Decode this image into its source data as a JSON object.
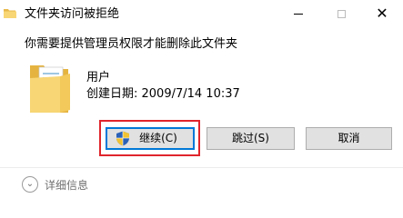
{
  "window": {
    "title": "文件夹访问被拒绝",
    "controls": {
      "minimize": "minimize-icon",
      "maximize": "maximize-icon",
      "close": "close-icon"
    }
  },
  "message": "你需要提供管理员权限才能删除此文件夹",
  "file": {
    "name": "用户",
    "created": "创建日期: 2009/7/14 10:37",
    "icon": "folder-icon"
  },
  "buttons": {
    "continue": "继续(C)",
    "skip": "跳过(S)",
    "cancel": "取消"
  },
  "details": {
    "label": "详细信息",
    "icon": "chevron-down-icon"
  },
  "colors": {
    "accent": "#0078d7",
    "highlight": "#e0252c",
    "folder": "#f8d675"
  }
}
